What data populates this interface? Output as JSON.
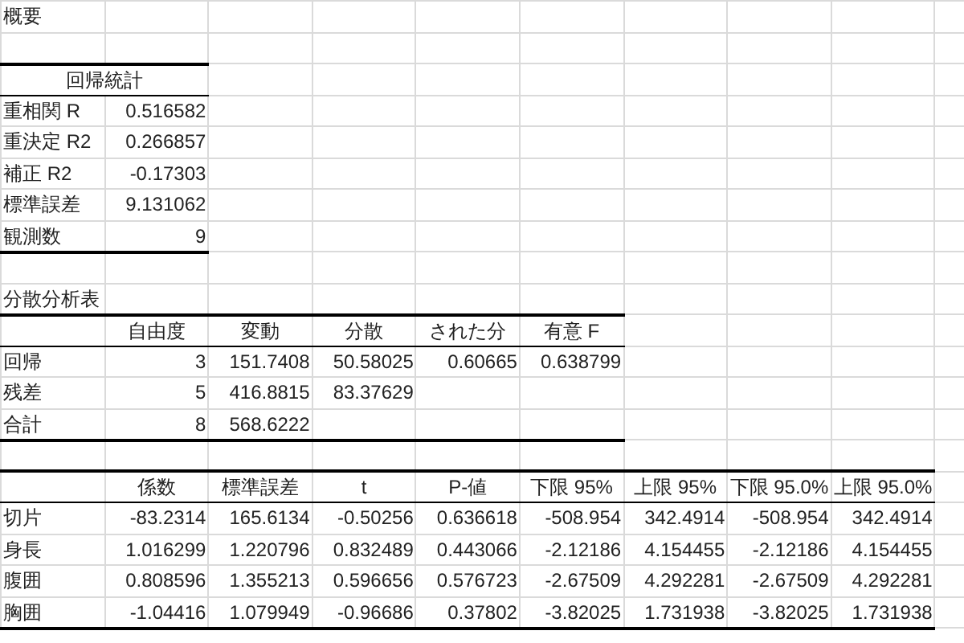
{
  "title": "概要",
  "regression_stats": {
    "header": "回帰統計",
    "rows": [
      {
        "label": "重相関 R",
        "value": "0.516582"
      },
      {
        "label": "重決定 R2",
        "value": "0.266857"
      },
      {
        "label": "補正 R2",
        "value": "-0.17303"
      },
      {
        "label": "標準誤差",
        "value": "9.131062"
      },
      {
        "label": "観測数",
        "value": "9"
      }
    ]
  },
  "anova": {
    "title": "分散分析表",
    "columns": [
      "自由度",
      "変動",
      "分散",
      "された分",
      "有意 F"
    ],
    "rows": [
      {
        "label": "回帰",
        "values": [
          "3",
          "151.7408",
          "50.58025",
          "0.60665",
          "0.638799"
        ]
      },
      {
        "label": "残差",
        "values": [
          "5",
          "416.8815",
          "83.37629"
        ]
      },
      {
        "label": "合計",
        "values": [
          "8",
          "568.6222"
        ]
      }
    ]
  },
  "coefficients": {
    "columns": [
      "係数",
      "標準誤差",
      "t",
      "P-値",
      "下限 95%",
      "上限 95%",
      "下限 95.0%",
      "上限 95.0%"
    ],
    "rows": [
      {
        "label": "切片",
        "values": [
          "-83.2314",
          "165.6134",
          "-0.50256",
          "0.636618",
          "-508.954",
          "342.4914",
          "-508.954",
          "342.4914"
        ]
      },
      {
        "label": "身長",
        "values": [
          "1.016299",
          "1.220796",
          "0.832489",
          "0.443066",
          "-2.12186",
          "4.154455",
          "-2.12186",
          "4.154455"
        ]
      },
      {
        "label": "腹囲",
        "values": [
          "0.808596",
          "1.355213",
          "0.596656",
          "0.576723",
          "-2.67509",
          "4.292281",
          "-2.67509",
          "4.292281"
        ]
      },
      {
        "label": "胸囲",
        "values": [
          "-1.04416",
          "1.079949",
          "-0.96686",
          "0.37802",
          "-3.82025",
          "1.731938",
          "-3.82025",
          "1.731938"
        ]
      }
    ]
  }
}
